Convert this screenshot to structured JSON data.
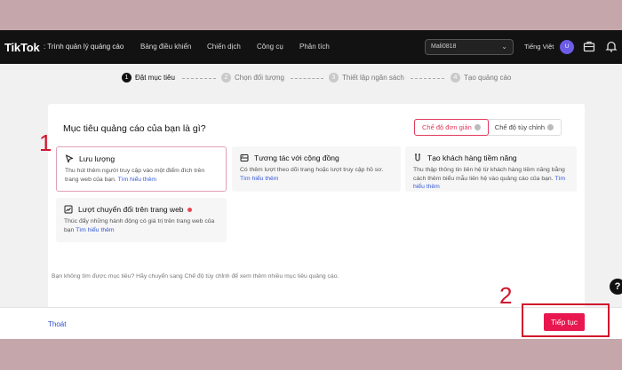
{
  "header": {
    "logo": "TikTok",
    "logo_sub": ": Trình quản lý quảng cáo",
    "nav": [
      "Bảng điều khiển",
      "Chiến dịch",
      "Công cụ",
      "Phân tích"
    ],
    "account": "Mali0818",
    "language": "Tiếng Việt",
    "avatar_letter": "U"
  },
  "steps": [
    {
      "num": "1",
      "label": "Đặt mục tiêu"
    },
    {
      "num": "2",
      "label": "Chọn đối tượng"
    },
    {
      "num": "3",
      "label": "Thiết lập ngân sách"
    },
    {
      "num": "4",
      "label": "Tạo quảng cáo"
    }
  ],
  "main": {
    "question": "Mục tiêu quảng cáo của bạn là gì?",
    "modes": [
      "Chế độ đơn giản",
      "Chế độ tùy chỉnh"
    ],
    "options": [
      {
        "title": "Lưu lượng",
        "desc": "Thu hút thêm người truy cập vào một điểm đích trên trang web của bạn.",
        "link": "Tìm hiểu thêm"
      },
      {
        "title": "Tương tác với cộng đồng",
        "desc": "Có thêm lượt theo dõi trang hoặc lượt truy cập hồ sơ.",
        "link": "Tìm hiểu thêm"
      },
      {
        "title": "Tạo khách hàng tiềm năng",
        "desc": "Thu thập thông tin liên hệ từ khách hàng tiềm năng bằng cách thêm biểu mẫu liên hệ vào quảng cáo của bạn.",
        "link": "Tìm hiểu thêm"
      },
      {
        "title": "Lượt chuyển đổi trên trang web",
        "desc": "Thúc đẩy những hành động có giá trị trên trang web của bạn",
        "link": "Tìm hiểu thêm"
      }
    ],
    "hint": "Bạn không tìm được mục tiêu? Hãy chuyển sang Chế độ tùy chỉnh để xem thêm nhiều mục tiêu quảng cáo."
  },
  "footer": {
    "exit": "Thoát",
    "next": "Tiếp tục"
  },
  "annotations": {
    "one": "1",
    "two": "2"
  },
  "help_label": "?",
  "colors": {
    "accent": "#e8174f",
    "annotation": "#d0162e",
    "link": "#3559d6"
  }
}
